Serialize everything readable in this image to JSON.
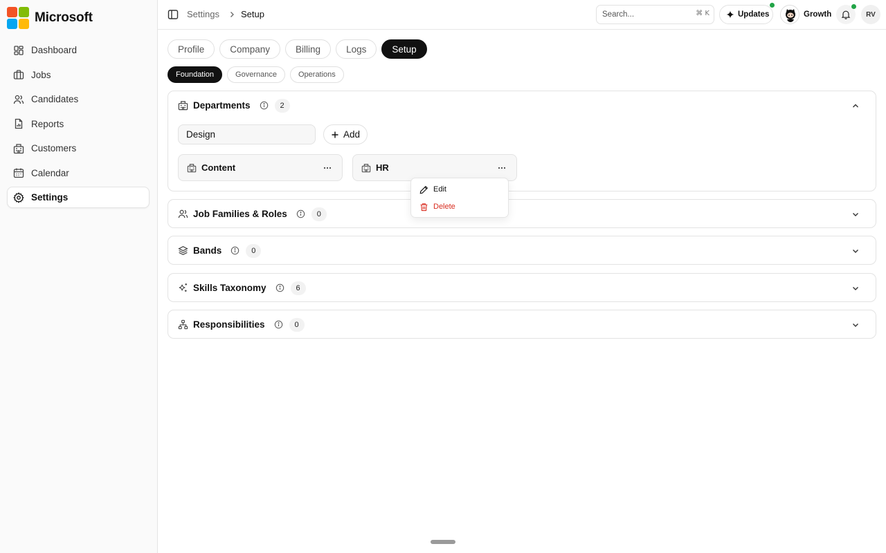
{
  "brand": {
    "name": "Microsoft",
    "logo_colors": [
      "#f35325",
      "#81bc06",
      "#05a6f0",
      "#ffba08"
    ]
  },
  "sidebar": {
    "items": [
      {
        "label": "Dashboard",
        "icon": "dashboard-icon"
      },
      {
        "label": "Jobs",
        "icon": "briefcase-icon"
      },
      {
        "label": "Candidates",
        "icon": "users-icon"
      },
      {
        "label": "Reports",
        "icon": "report-icon"
      },
      {
        "label": "Customers",
        "icon": "building-icon"
      },
      {
        "label": "Calendar",
        "icon": "calendar-icon"
      },
      {
        "label": "Settings",
        "icon": "gear-icon",
        "active": true
      }
    ]
  },
  "header": {
    "breadcrumb": [
      "Settings",
      "Setup"
    ],
    "search_placeholder": "Search...",
    "search_shortcut": "⌘ K",
    "updates_label": "Updates",
    "workspace_name": "Growth",
    "user_initials": "RV"
  },
  "tabs": [
    {
      "label": "Profile"
    },
    {
      "label": "Company"
    },
    {
      "label": "Billing"
    },
    {
      "label": "Logs"
    },
    {
      "label": "Setup",
      "active": true
    }
  ],
  "subtabs": [
    {
      "label": "Foundation",
      "active": true
    },
    {
      "label": "Governance"
    },
    {
      "label": "Operations"
    }
  ],
  "sections": [
    {
      "title": "Departments",
      "count": "2",
      "icon": "building-icon",
      "expanded": true
    },
    {
      "title": "Job Families & Roles",
      "count": "0",
      "icon": "users-icon"
    },
    {
      "title": "Bands",
      "count": "0",
      "icon": "layers-icon"
    },
    {
      "title": "Skills Taxonomy",
      "count": "6",
      "icon": "sparkles-icon"
    },
    {
      "title": "Responsibilities",
      "count": "0",
      "icon": "hierarchy-icon"
    }
  ],
  "departments": {
    "input_value": "Design",
    "add_label": "Add",
    "items": [
      {
        "name": "Content"
      },
      {
        "name": "HR"
      }
    ]
  },
  "context_menu": {
    "edit_label": "Edit",
    "delete_label": "Delete"
  },
  "colors": {
    "accent": "#111111",
    "danger": "#d92d20",
    "online": "#22a447"
  }
}
